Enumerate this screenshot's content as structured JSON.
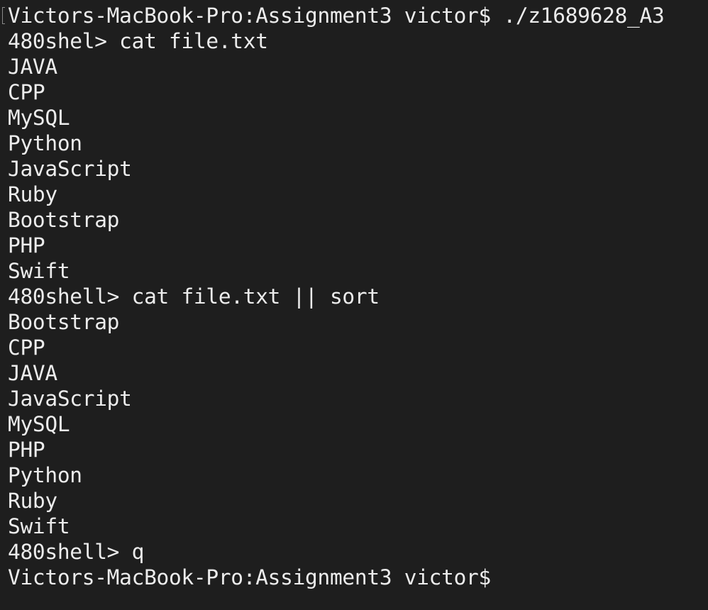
{
  "terminal": {
    "lines": [
      "Victors-MacBook-Pro:Assignment3 victor$ ./z1689628_A3",
      "480shel> cat file.txt",
      "JAVA",
      "CPP",
      "MySQL",
      "Python",
      "JavaScript",
      "Ruby",
      "Bootstrap",
      "PHP",
      "Swift",
      "480shell> cat file.txt || sort",
      "Bootstrap",
      "CPP",
      "JAVA",
      "JavaScript",
      "MySQL",
      "PHP",
      "Python",
      "Ruby",
      "Swift",
      "480shell> q",
      "Victors-MacBook-Pro:Assignment3 victor$"
    ]
  },
  "colors": {
    "background": "#1e1e1e",
    "text": "#ececec"
  }
}
